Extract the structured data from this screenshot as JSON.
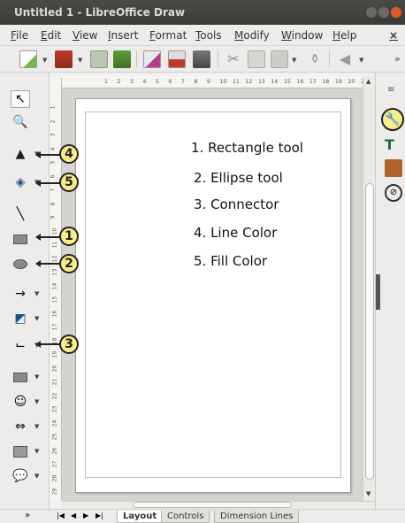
{
  "window": {
    "title": "Untitled 1 - LibreOffice Draw"
  },
  "menu": [
    "File",
    "Edit",
    "View",
    "Insert",
    "Format",
    "Tools",
    "Modify",
    "Window",
    "Help"
  ],
  "menu_close": "×",
  "toolbar": {
    "overflow": "»"
  },
  "rulers": {
    "h_ticks": [
      "1",
      "2",
      "3",
      "4",
      "5",
      "6",
      "7",
      "8",
      "9",
      "10",
      "11",
      "12",
      "13",
      "14",
      "15",
      "16",
      "17",
      "18",
      "19",
      "20",
      "21"
    ],
    "v_ticks": [
      "1",
      "2",
      "3",
      "4",
      "5",
      "6",
      "7",
      "8",
      "9",
      "10",
      "11",
      "12",
      "13",
      "14",
      "15",
      "16",
      "17",
      "18",
      "19",
      "20",
      "21",
      "22",
      "23",
      "24",
      "25",
      "26",
      "27",
      "28",
      "29"
    ]
  },
  "legend": [
    "1.  Rectangle tool",
    "2.  Ellipse tool",
    "3.  Connector",
    "4.  Line Color",
    "5.  Fill Color"
  ],
  "callouts": [
    "4",
    "5",
    "1",
    "2",
    "3"
  ],
  "tabs": [
    "Layout",
    "Controls",
    "Dimension Lines"
  ],
  "bottom": {
    "more": "»",
    "nav": [
      "|◀",
      "◀",
      "▶",
      "▶|"
    ]
  },
  "colors": {
    "callout_fill": "#f8ec8c",
    "title_bg": "#3c3b37",
    "close_button": "#e0592a"
  }
}
